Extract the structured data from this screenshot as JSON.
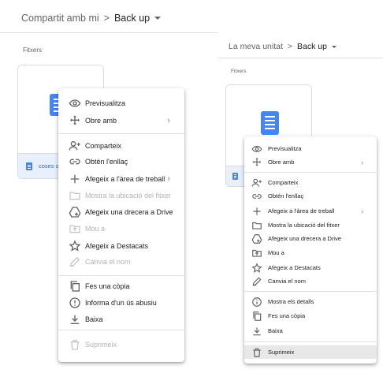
{
  "left": {
    "breadcrumb": {
      "parent": "Compartit amb mi",
      "separator": ">",
      "current": "Back up"
    },
    "section_label": "Fitxers",
    "file_name": "coses s",
    "menu": {
      "items": [
        {
          "icon": "eye-icon",
          "label": "Previsualitza"
        },
        {
          "icon": "move-arrows-icon",
          "label": "Obre amb",
          "submenu": true
        },
        {
          "icon": "add-person-icon",
          "label": "Comparteix"
        },
        {
          "icon": "link-icon",
          "label": "Obtén l'enllaç"
        },
        {
          "icon": "plus-icon",
          "label": "Afegeix a l'àrea de treball",
          "submenu": true
        },
        {
          "icon": "folder-icon",
          "label": "Mostra la ubicació del fitxer",
          "disabled": true
        },
        {
          "icon": "drive-shortcut-icon",
          "label": "Afegeix una drecera a Drive"
        },
        {
          "icon": "move-to-icon",
          "label": "Mou a",
          "disabled": true
        },
        {
          "icon": "star-icon",
          "label": "Afegeix a Destacats"
        },
        {
          "icon": "pencil-icon",
          "label": "Canvia el nom",
          "disabled": true
        },
        {
          "icon": "copy-icon",
          "label": "Fes una còpia"
        },
        {
          "icon": "report-icon",
          "label": "Informa d'un ús abusiu"
        },
        {
          "icon": "download-icon",
          "label": "Baixa"
        },
        {
          "icon": "trash-icon",
          "label": "Suprimeix",
          "disabled": true
        }
      ]
    }
  },
  "right": {
    "breadcrumb": {
      "parent": "La meva unitat",
      "separator": ">",
      "current": "Back up"
    },
    "section_label": "Fitxers",
    "menu": {
      "items": [
        {
          "icon": "eye-icon",
          "label": "Previsualitza"
        },
        {
          "icon": "move-arrows-icon",
          "label": "Obre amb",
          "submenu": true
        },
        {
          "icon": "add-person-icon",
          "label": "Comparteix"
        },
        {
          "icon": "link-icon",
          "label": "Obtén l'enllaç"
        },
        {
          "icon": "plus-icon",
          "label": "Afegeix a l'àrea de treball",
          "submenu": true
        },
        {
          "icon": "folder-icon",
          "label": "Mostra la ubicació del fitxer"
        },
        {
          "icon": "drive-shortcut-icon",
          "label": "Afegeix una drecera a Drive"
        },
        {
          "icon": "move-to-icon",
          "label": "Mou a"
        },
        {
          "icon": "star-icon",
          "label": "Afegeix a Destacats"
        },
        {
          "icon": "pencil-icon",
          "label": "Canvia el nom"
        },
        {
          "icon": "info-icon",
          "label": "Mostra els detalls"
        },
        {
          "icon": "copy-icon",
          "label": "Fes una còpia"
        },
        {
          "icon": "download-icon",
          "label": "Baixa"
        },
        {
          "icon": "trash-icon",
          "label": "Suprimeix",
          "highlighted": true
        }
      ]
    }
  },
  "colors": {
    "doc_blue": "#4285f4",
    "selected_bg": "#e8f0fe",
    "highlight_bg": "#e8e8e8"
  }
}
